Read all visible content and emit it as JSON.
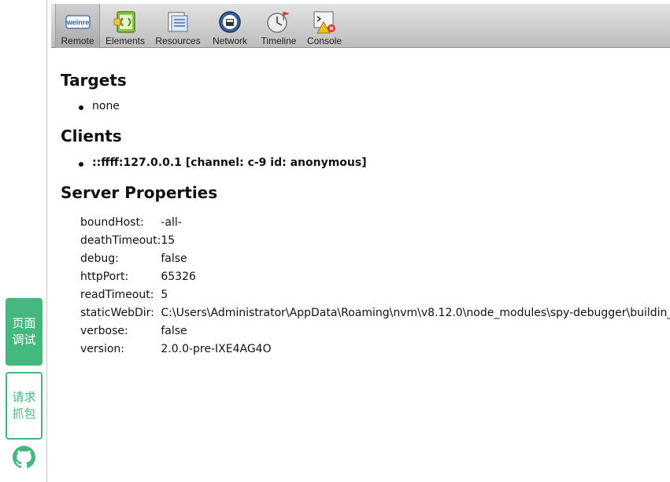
{
  "toolbar": {
    "items": [
      {
        "label": "Remote",
        "icon": "weinre-logo-icon"
      },
      {
        "label": "Elements",
        "icon": "elements-icon"
      },
      {
        "label": "Resources",
        "icon": "resources-icon"
      },
      {
        "label": "Network",
        "icon": "network-icon"
      },
      {
        "label": "Timeline",
        "icon": "timeline-icon"
      },
      {
        "label": "Console",
        "icon": "console-icon"
      }
    ],
    "logo_text": "weinre",
    "selected": "Remote"
  },
  "rail": {
    "page_debug": "页面\n调试",
    "page_debug_l1": "页面",
    "page_debug_l2": "调试",
    "capture_l1": "请求",
    "capture_l2": "抓包",
    "github_icon": "github-icon",
    "accent_color": "#45b880"
  },
  "targets": {
    "heading": "Targets",
    "items": [
      "none"
    ]
  },
  "clients": {
    "heading": "Clients",
    "items": [
      "::ffff:127.0.0.1 [channel: c-9 id: anonymous]"
    ]
  },
  "server_properties": {
    "heading": "Server Properties",
    "rows": [
      {
        "key": "boundHost:",
        "value": "-all-"
      },
      {
        "key": "deathTimeout:",
        "value": "15"
      },
      {
        "key": "debug:",
        "value": "false"
      },
      {
        "key": "httpPort:",
        "value": "65326"
      },
      {
        "key": "readTimeout:",
        "value": "5"
      },
      {
        "key": "staticWebDir:",
        "value": "C:\\Users\\Administrator\\AppData\\Roaming\\nvm\\v8.12.0\\node_modules\\spy-debugger\\buildin_m"
      },
      {
        "key": "verbose:",
        "value": "false"
      },
      {
        "key": "version:",
        "value": "2.0.0-pre-IXE4AG4O"
      }
    ]
  }
}
